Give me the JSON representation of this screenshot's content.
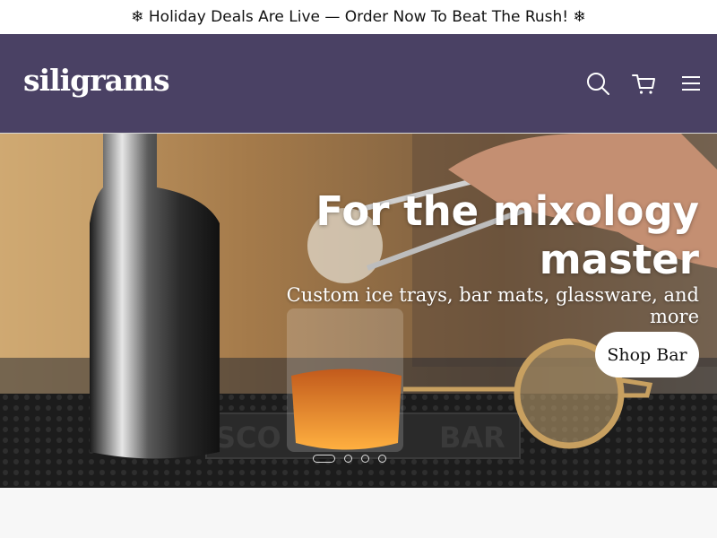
{
  "announcement": "❄ Holiday Deals Are Live — Order Now To Beat The Rush! ❄",
  "brand": {
    "name": "siligrams"
  },
  "header": {
    "icons": [
      "search-icon",
      "cart-icon",
      "menu-icon"
    ],
    "background": "#4a4164"
  },
  "hero": {
    "title": "For the mixology master",
    "subtitle": "Custom ice trays, bar mats, glassware, and more",
    "cta_label": "Shop Bar",
    "mat_text": "SCO BAR",
    "slides": {
      "count": 4,
      "active": 1
    }
  }
}
